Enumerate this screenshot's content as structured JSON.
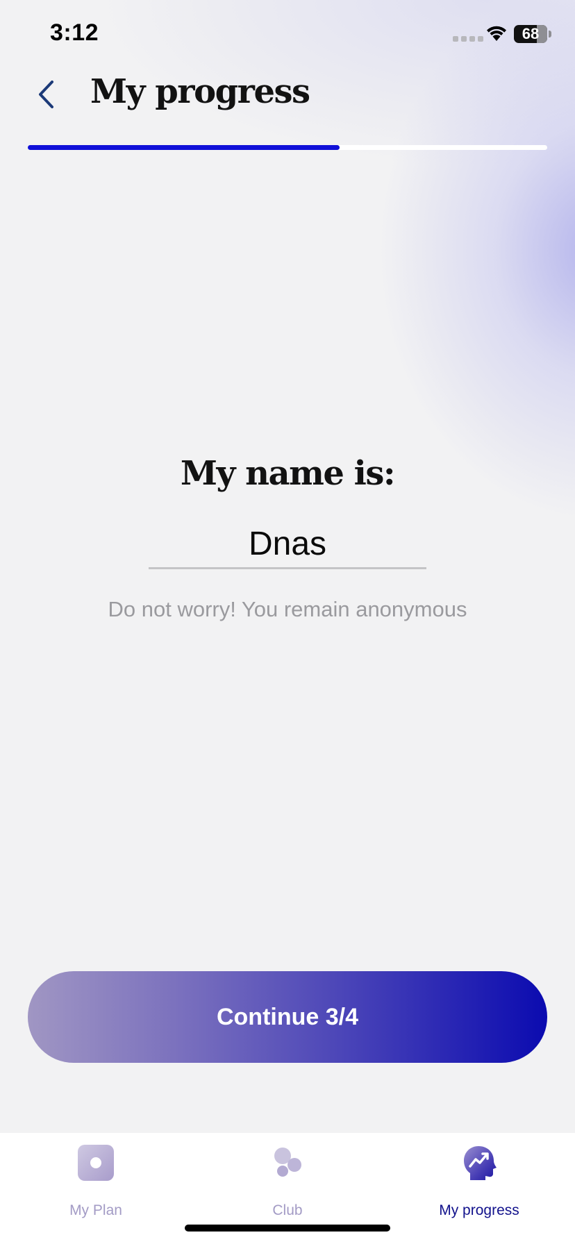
{
  "status_bar": {
    "time": "3:12",
    "battery": "68",
    "icons": [
      "signal-icon",
      "wifi-icon",
      "battery-icon"
    ]
  },
  "header": {
    "title": "My progress",
    "back_icon": "chevron-left-icon",
    "progress_fraction": 0.6
  },
  "main": {
    "heading": "My name is:",
    "name_value": "Dnas",
    "helper_text": "Do not worry! You remain anonymous"
  },
  "continue_button": {
    "label": "Continue 3/4"
  },
  "tab_bar": {
    "tabs": [
      {
        "label": "My Plan",
        "icon": "plan-icon",
        "active": false
      },
      {
        "label": "Club",
        "icon": "club-icon",
        "active": false
      },
      {
        "label": "My progress",
        "icon": "progress-head-icon",
        "active": true
      }
    ]
  },
  "colors": {
    "accent": "#1010d8",
    "tab_active": "#12128c",
    "tab_inactive": "#a39bc5",
    "button_gradient_start": "#a096c3",
    "button_gradient_end": "#0b0bb0"
  }
}
